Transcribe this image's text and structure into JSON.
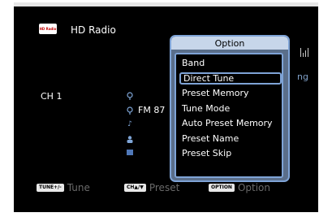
{
  "source": {
    "logo_text": "HD Radio",
    "name": "HD Radio"
  },
  "partial_right_text": "ng",
  "channel": "CH 1",
  "frequency": "FM 87",
  "option_menu": {
    "title": "Option",
    "items": [
      {
        "label": "Band"
      },
      {
        "label": "Direct Tune",
        "selected": true
      },
      {
        "label": "Preset Memory"
      },
      {
        "label": "Tune Mode"
      },
      {
        "label": "Auto Preset Memory"
      },
      {
        "label": "Preset Name"
      },
      {
        "label": "Preset Skip"
      }
    ]
  },
  "bottom_bar": {
    "tune": {
      "key": "TUNE+/-",
      "label": "Tune"
    },
    "preset": {
      "key": "CH▲/▼",
      "label": "Preset"
    },
    "option": {
      "key": "OPTION",
      "label": "Option"
    }
  },
  "icons": {
    "hd_logo": "hd-radio-logo-icon",
    "signal": "signal-strength-icon",
    "station": "station-icon",
    "music": "music-note-icon",
    "artist": "artist-icon",
    "pty": "pty-icon"
  },
  "colors": {
    "panel_border": "#7ea3d6",
    "panel_header": "#c7d6ea",
    "icon_blue": "#7fa6d8"
  }
}
